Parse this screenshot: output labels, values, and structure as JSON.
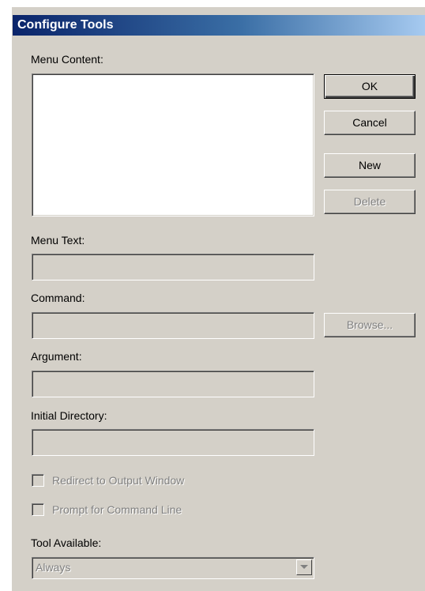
{
  "window": {
    "title": "Configure Tools"
  },
  "menu_content": {
    "label": "Menu Content:",
    "items": []
  },
  "buttons": {
    "ok": "OK",
    "cancel": "Cancel",
    "new": "New",
    "delete": "Delete",
    "browse": "Browse..."
  },
  "fields": {
    "menu_text": {
      "label": "Menu Text:",
      "value": ""
    },
    "command": {
      "label": "Command:",
      "value": ""
    },
    "argument": {
      "label": "Argument:",
      "value": ""
    },
    "initial_directory": {
      "label": "Initial Directory:",
      "value": ""
    }
  },
  "checkboxes": {
    "redirect_output": {
      "label": "Redirect to Output Window",
      "checked": false,
      "enabled": false
    },
    "prompt_command_line": {
      "label": "Prompt for Command Line",
      "checked": false,
      "enabled": false
    }
  },
  "tool_available": {
    "label": "Tool Available:",
    "selected": "Always"
  },
  "colors": {
    "dialog_face": "#d4d0c8",
    "title_start": "#0a246a",
    "title_end": "#a6caf0",
    "disabled_text": "#808080"
  }
}
